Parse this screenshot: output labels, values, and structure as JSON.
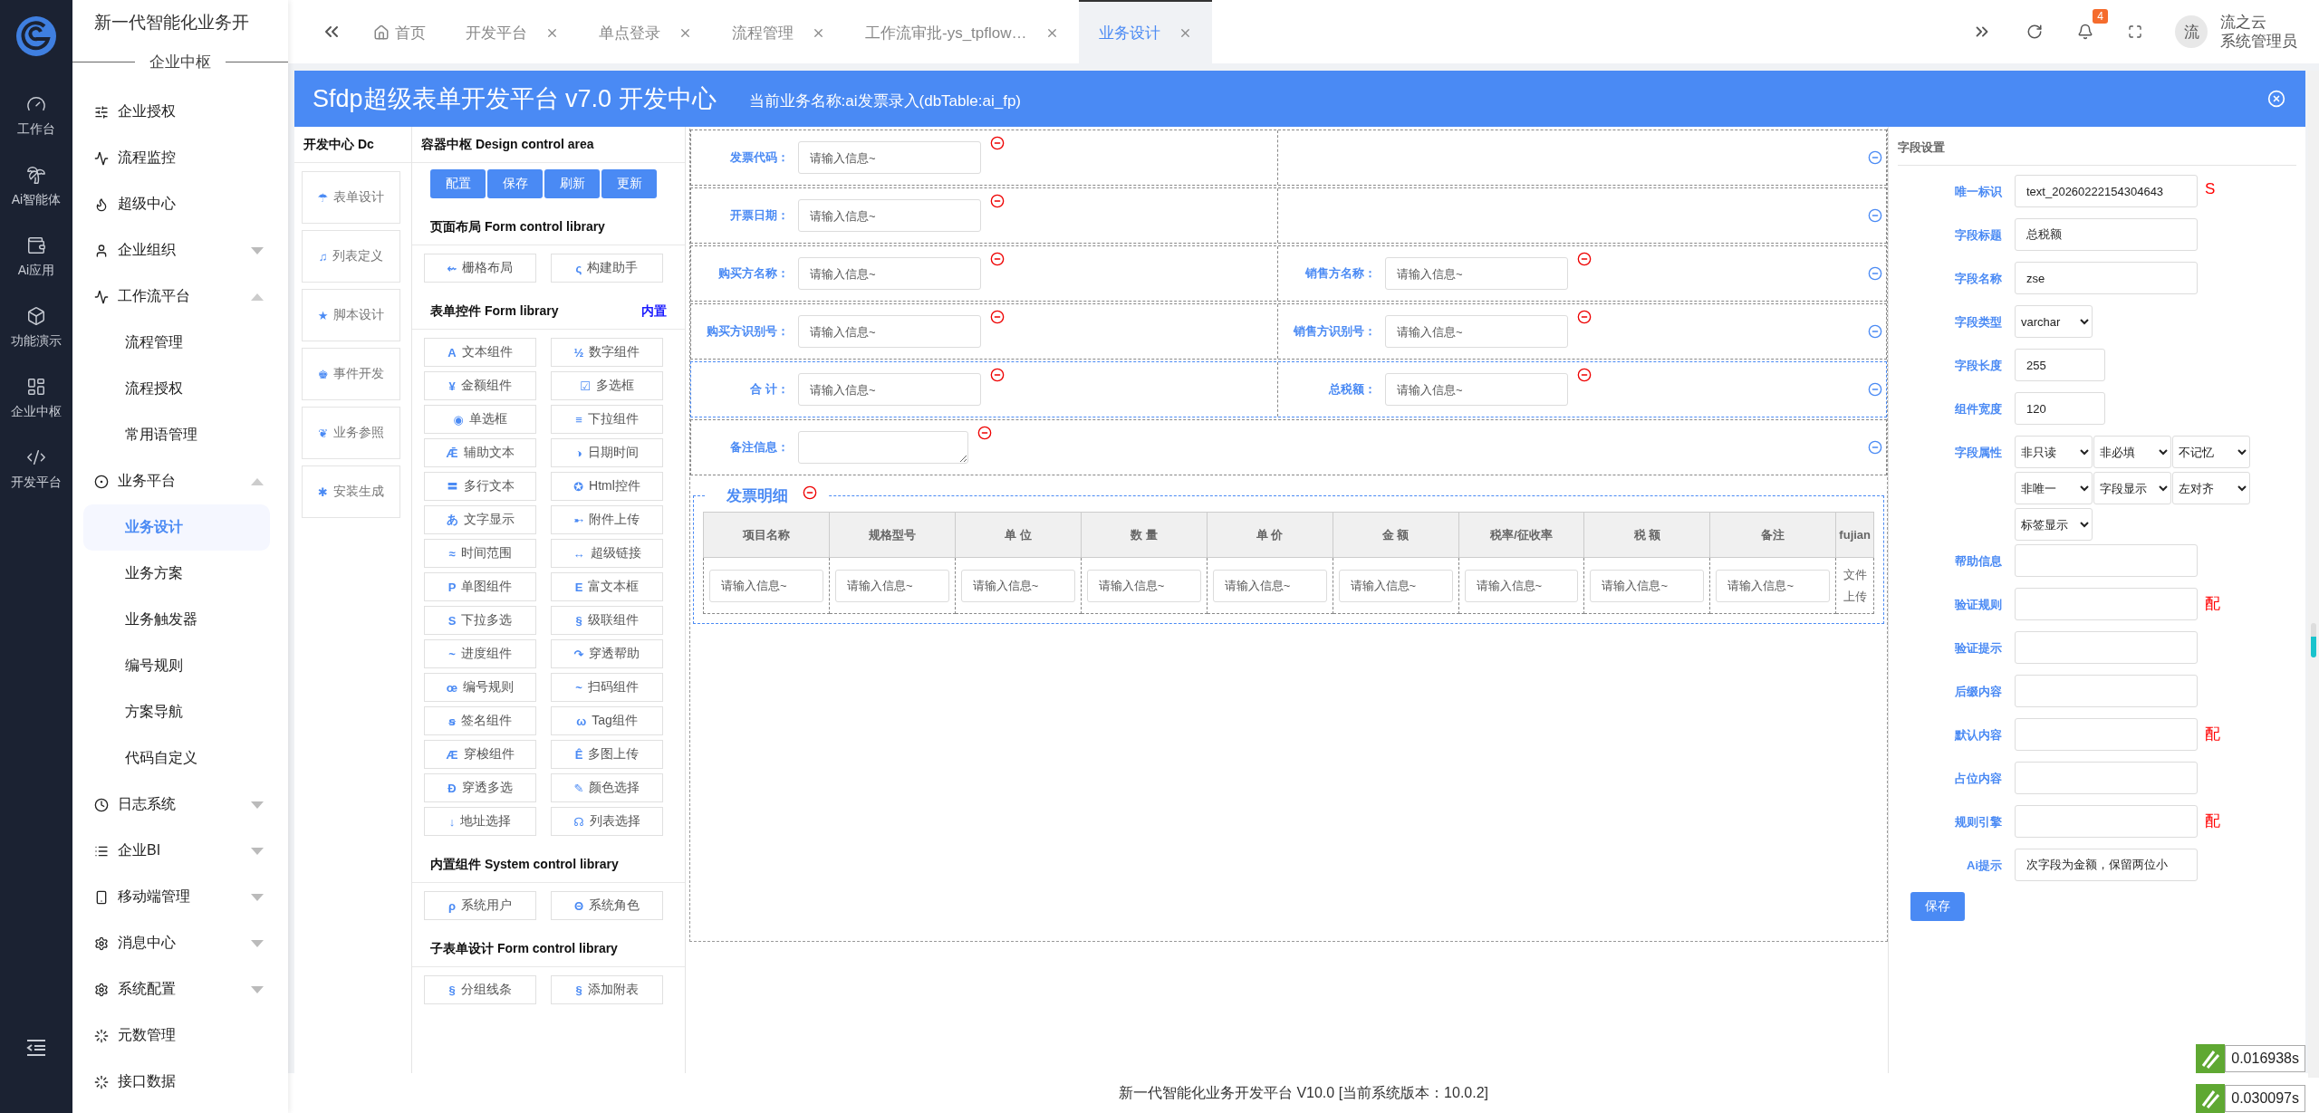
{
  "rail": {
    "items": [
      {
        "label": "工作台"
      },
      {
        "label": "Ai智能体"
      },
      {
        "label": "Ai应用"
      },
      {
        "label": "功能演示"
      },
      {
        "label": "企业中枢"
      },
      {
        "label": "开发平台"
      }
    ]
  },
  "menu": {
    "title": "新一代智能化业务开",
    "section": "企业中枢",
    "items": [
      {
        "label": "企业授权",
        "selected": false
      },
      {
        "label": "流程监控",
        "selected": false
      },
      {
        "label": "超级中心",
        "selected": false
      },
      {
        "label": "企业组织",
        "selected": false,
        "expanded": false
      },
      {
        "label": "工作流平台",
        "selected": false,
        "expanded": true,
        "children": [
          {
            "label": "流程管理",
            "selected": false
          },
          {
            "label": "流程授权",
            "selected": false
          },
          {
            "label": "常用语管理",
            "selected": false
          }
        ]
      },
      {
        "label": "业务平台",
        "selected": false,
        "expanded": true,
        "children": [
          {
            "label": "业务设计",
            "selected": true
          },
          {
            "label": "业务方案",
            "selected": false
          },
          {
            "label": "业务触发器",
            "selected": false
          },
          {
            "label": "编号规则",
            "selected": false
          },
          {
            "label": "方案导航",
            "selected": false
          },
          {
            "label": "代码自定义",
            "selected": false
          }
        ]
      },
      {
        "label": "日志系统",
        "selected": false,
        "expanded": false
      },
      {
        "label": "企业BI",
        "selected": false,
        "expanded": false
      },
      {
        "label": "移动端管理",
        "selected": false,
        "expanded": false
      },
      {
        "label": "消息中心",
        "selected": false,
        "expanded": false
      },
      {
        "label": "系统配置",
        "selected": false,
        "expanded": false
      },
      {
        "label": "元数管理",
        "selected": false
      },
      {
        "label": "接口数据",
        "selected": false
      }
    ]
  },
  "tabs": [
    {
      "label": "首页",
      "kind": "home",
      "selected": false
    },
    {
      "label": "开发平台",
      "kind": "closable",
      "selected": false
    },
    {
      "label": "单点登录",
      "kind": "closable",
      "selected": false
    },
    {
      "label": "流程管理",
      "kind": "closable",
      "selected": false
    },
    {
      "label": "工作流审批-ys_tpflow…",
      "kind": "closable",
      "selected": false
    },
    {
      "label": "业务设计",
      "kind": "closable",
      "selected": true
    }
  ],
  "header": {
    "notifications": "4",
    "avatar": "流",
    "user_name": "流之云",
    "user_role": "系统管理员"
  },
  "dialog": {
    "title": "Sfdp超级表单开发平台 v7.0 开发中心",
    "subtitle": "当前业务名称:ai发票录入(dbTable:ai_fp)",
    "nav": {
      "heading": "开发中心 Dc",
      "items": [
        {
          "glyph": "☂",
          "label": "表单设计"
        },
        {
          "glyph": "♫",
          "label": "列表定义"
        },
        {
          "glyph": "★",
          "label": "脚本设计"
        },
        {
          "glyph": "♚",
          "label": "事件开发"
        },
        {
          "glyph": "❦",
          "label": "业务参照"
        },
        {
          "glyph": "✱",
          "label": "安装生成"
        }
      ]
    },
    "library": {
      "heading": "容器中枢 Design control area",
      "buttons": [
        "配置",
        "保存",
        "刷新",
        "更新"
      ],
      "sections": [
        {
          "title": "页面布局 Form control library",
          "items": [
            {
              "glyph": "⇜",
              "label": "栅格布局"
            },
            {
              "glyph": "ς",
              "label": "构建助手"
            }
          ]
        },
        {
          "title": "表单控件 Form library",
          "link": "内置",
          "items": [
            {
              "glyph": "A",
              "label": "文本组件"
            },
            {
              "glyph": "½",
              "label": "数字组件"
            },
            {
              "glyph": "¥",
              "label": "金额组件"
            },
            {
              "glyph": "☑",
              "label": "多选框"
            },
            {
              "glyph": "◉",
              "label": "单选框"
            },
            {
              "glyph": "≡",
              "label": "下拉组件"
            },
            {
              "glyph": "Ǣ",
              "label": "辅助文本"
            },
            {
              "glyph": "◑",
              "label": "日期时间"
            },
            {
              "glyph": "〓",
              "label": "多行文本"
            },
            {
              "glyph": "✪",
              "label": "Html控件"
            },
            {
              "glyph": "あ",
              "label": "文字显示"
            },
            {
              "glyph": "➸",
              "label": "附件上传"
            },
            {
              "glyph": "≈",
              "label": "时间范围"
            },
            {
              "glyph": "↔",
              "label": "超级链接"
            },
            {
              "glyph": "P",
              "label": "单图组件"
            },
            {
              "glyph": "E",
              "label": "富文本框"
            },
            {
              "glyph": "S",
              "label": "下拉多选"
            },
            {
              "glyph": "§",
              "label": "级联组件"
            },
            {
              "glyph": "~",
              "label": "进度组件"
            },
            {
              "glyph": "↷",
              "label": "穿透帮助"
            },
            {
              "glyph": "œ",
              "label": "编号规则"
            },
            {
              "glyph": "~",
              "label": "扫码组件"
            },
            {
              "glyph": "ꞩ",
              "label": "签名组件"
            },
            {
              "glyph": "ω",
              "label": "Tag组件"
            },
            {
              "glyph": "Æ",
              "label": "穿梭组件"
            },
            {
              "glyph": "Ê",
              "label": "多图上传"
            },
            {
              "glyph": "Đ",
              "label": "穿透多选"
            },
            {
              "glyph": "✎",
              "label": "颜色选择"
            },
            {
              "glyph": "↓",
              "label": "地址选择"
            },
            {
              "glyph": "☊",
              "label": "列表选择"
            }
          ]
        },
        {
          "title": "内置组件 System control library",
          "items": [
            {
              "glyph": "ρ",
              "label": "系统用户"
            },
            {
              "glyph": "Θ",
              "label": "系统角色"
            }
          ]
        },
        {
          "title": "子表单设计 Form control library",
          "items": [
            {
              "glyph": "§",
              "label": "分组线条"
            },
            {
              "glyph": "§",
              "label": "添加附表"
            }
          ]
        }
      ]
    },
    "form": {
      "rows": [
        {
          "selected": false,
          "cells": [
            {
              "kind": "input",
              "label": "发票代码：",
              "placeholder": "请输入信息~"
            },
            {
              "kind": "empty"
            }
          ]
        },
        {
          "selected": false,
          "cells": [
            {
              "kind": "input",
              "label": "开票日期：",
              "placeholder": "请输入信息~"
            },
            {
              "kind": "empty"
            }
          ]
        },
        {
          "selected": false,
          "cells": [
            {
              "kind": "input",
              "label": "购买方名称：",
              "placeholder": "请输入信息~"
            },
            {
              "kind": "input",
              "label": "销售方名称：",
              "placeholder": "请输入信息~"
            }
          ]
        },
        {
          "selected": false,
          "cells": [
            {
              "kind": "input",
              "label": "购买方识别号：",
              "placeholder": "请输入信息~"
            },
            {
              "kind": "input",
              "label": "销售方识别号：",
              "placeholder": "请输入信息~"
            }
          ]
        },
        {
          "selected": true,
          "cells": [
            {
              "kind": "input",
              "label": "合 计：",
              "placeholder": "请输入信息~"
            },
            {
              "kind": "input",
              "label": "总税额：",
              "placeholder": "请输入信息~"
            }
          ]
        },
        {
          "selected": false,
          "cells": [
            {
              "kind": "textarea",
              "label": "备注信息："
            }
          ]
        }
      ],
      "subtable": {
        "title": "发票明细",
        "columns": [
          "项目名称",
          "规格型号",
          "单 位",
          "数 量",
          "单 价",
          "金 额",
          "税率/征收率",
          "税 额",
          "备注",
          "fujian"
        ],
        "cells": [
          {
            "kind": "input",
            "placeholder": "请输入信息~"
          },
          {
            "kind": "input",
            "placeholder": "请输入信息~"
          },
          {
            "kind": "input",
            "placeholder": "请输入信息~"
          },
          {
            "kind": "input",
            "placeholder": "请输入信息~"
          },
          {
            "kind": "input",
            "placeholder": "请输入信息~"
          },
          {
            "kind": "input",
            "placeholder": "请输入信息~"
          },
          {
            "kind": "input",
            "placeholder": "请输入信息~"
          },
          {
            "kind": "input",
            "placeholder": "请输入信息~"
          },
          {
            "kind": "input",
            "placeholder": "请输入信息~"
          },
          {
            "kind": "text",
            "text": "文件上传"
          }
        ]
      }
    },
    "settings": {
      "heading": "字段设置",
      "fields": [
        {
          "kind": "input",
          "label": "唯一标识",
          "value": "text_20260222154304643",
          "suffix": "S"
        },
        {
          "kind": "input",
          "label": "字段标题",
          "value": "总税额"
        },
        {
          "kind": "input",
          "label": "字段名称",
          "value": "zse"
        },
        {
          "kind": "select",
          "label": "字段类型",
          "values": [
            "varchar"
          ]
        },
        {
          "kind": "short",
          "label": "字段长度",
          "value": "255"
        },
        {
          "kind": "short",
          "label": "组件宽度",
          "value": "120"
        },
        {
          "kind": "select",
          "label": "字段属性",
          "values": [
            "非只读",
            "非必填",
            "不记忆",
            "非唯一",
            "字段显示",
            "左对齐",
            "标签显示"
          ]
        },
        {
          "kind": "input",
          "label": "帮助信息"
        },
        {
          "kind": "input",
          "label": "验证规则",
          "suffix": "配"
        },
        {
          "kind": "input",
          "label": "验证提示"
        },
        {
          "kind": "input",
          "label": "后缀内容"
        },
        {
          "kind": "input",
          "label": "默认内容",
          "suffix": "配"
        },
        {
          "kind": "input",
          "label": "占位内容"
        },
        {
          "kind": "input",
          "label": "规则引擎",
          "suffix": "配"
        },
        {
          "kind": "input",
          "label": "Ai提示",
          "value": "次字段为金额，保留两位小"
        }
      ],
      "save": "保存"
    }
  },
  "footer": "新一代智能化业务开发平台 V10.0 [当前系统版本：10.0.2]",
  "timings": [
    "0.016938s",
    "0.030097s"
  ]
}
